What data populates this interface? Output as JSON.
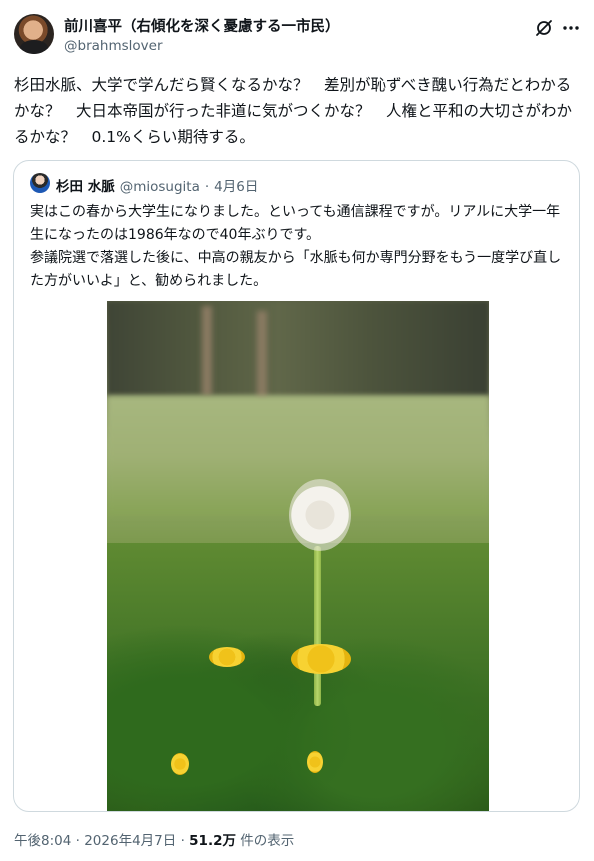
{
  "author": {
    "display_name": "前川喜平（右傾化を深く憂慮する一市民）",
    "handle": "@brahmslover"
  },
  "tweet": {
    "text": "杉田水脈、大学で学んだら賢くなるかな？　差別が恥ずべき醜い行為だとわかるかな？　大日本帝国が行った非道に気がつくかな？　人権と平和の大切さがわかるかな？　0.1%くらい期待する。"
  },
  "quote": {
    "display_name": "杉田 水脈",
    "handle": "@miosugita",
    "separator": "·",
    "date": "4月6日",
    "text_line1": "実はこの春から大学生になりました。といっても通信課程ですが。リアルに大学一年生になったのは1986年なので40年ぶりです。",
    "text_line2": "参議院選で落選した後に、中高の親友から「水脈も何か専門分野をもう一度学び直した方がいいよ」と、勧められました。"
  },
  "footer": {
    "time": "午後8:04",
    "separator": "·",
    "date": "2026年4月7日",
    "separator2": "·",
    "views": "51.2万",
    "views_label": "件の表示"
  },
  "icons": {
    "grok": "grok-icon",
    "more": "more-icon"
  },
  "colors": {
    "text": "#0f1419",
    "secondary": "#536471",
    "border": "#cfd9de"
  }
}
